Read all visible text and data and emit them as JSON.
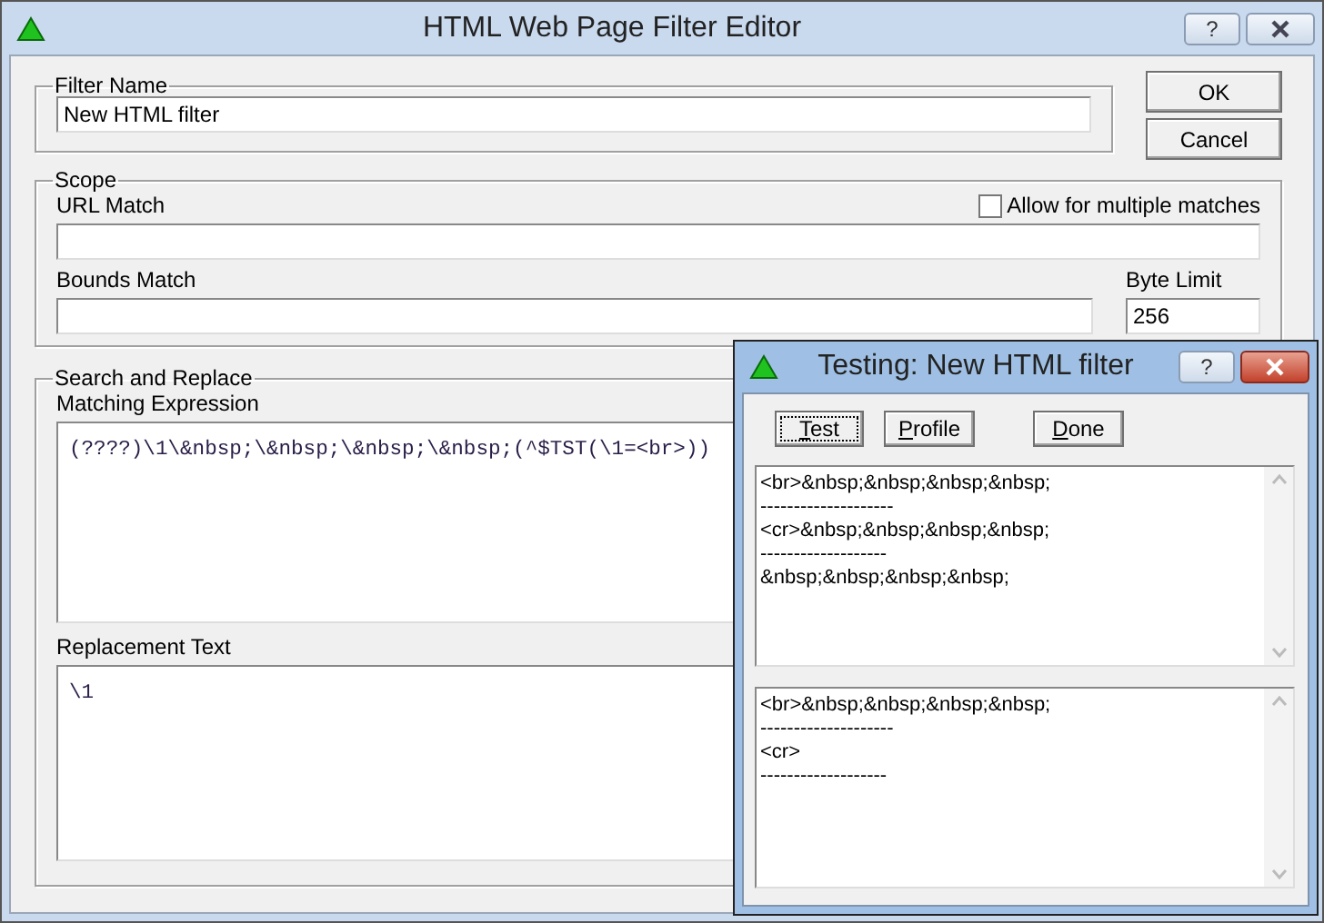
{
  "window": {
    "title": "HTML Web Page Filter Editor",
    "help_button": "?"
  },
  "filter_name": {
    "label": "Filter Name",
    "value": "New HTML filter"
  },
  "buttons": [
    "OK",
    "Cancel"
  ],
  "scope": {
    "label": "Scope",
    "url_match": {
      "label": "URL Match"
    },
    "allow_multiple": {
      "label": "Allow for multiple matches",
      "checked": false
    },
    "bounds_match": {
      "label": "Bounds Match"
    },
    "byte_limit": {
      "label": "Byte Limit",
      "value": "256"
    }
  },
  "search_replace": {
    "label": "Search and Replace",
    "matching_expression": {
      "label": "Matching Expression",
      "value": "(????)\\1\\&nbsp;\\&nbsp;\\&nbsp;\\&nbsp;(^$TST(\\1=<br>))"
    },
    "replacement_text": {
      "label": "Replacement Text",
      "value": "\\1"
    }
  },
  "testing_dialog": {
    "title": "Testing: New HTML filter",
    "help_button": "?",
    "buttons": [
      {
        "label": "Test",
        "focused": true
      },
      {
        "label": "Profile",
        "focused": false
      },
      {
        "label": "Done",
        "focused": false
      }
    ],
    "output_top": [
      "<br>&nbsp;&nbsp;&nbsp;&nbsp;",
      "--------------------",
      "<cr>&nbsp;&nbsp;&nbsp;&nbsp;",
      "-------------------",
      "&nbsp;&nbsp;&nbsp;&nbsp;"
    ],
    "output_bottom": [
      "<br>&nbsp;&nbsp;&nbsp;&nbsp;",
      "--------------------",
      "<cr>",
      "-------------------"
    ]
  }
}
